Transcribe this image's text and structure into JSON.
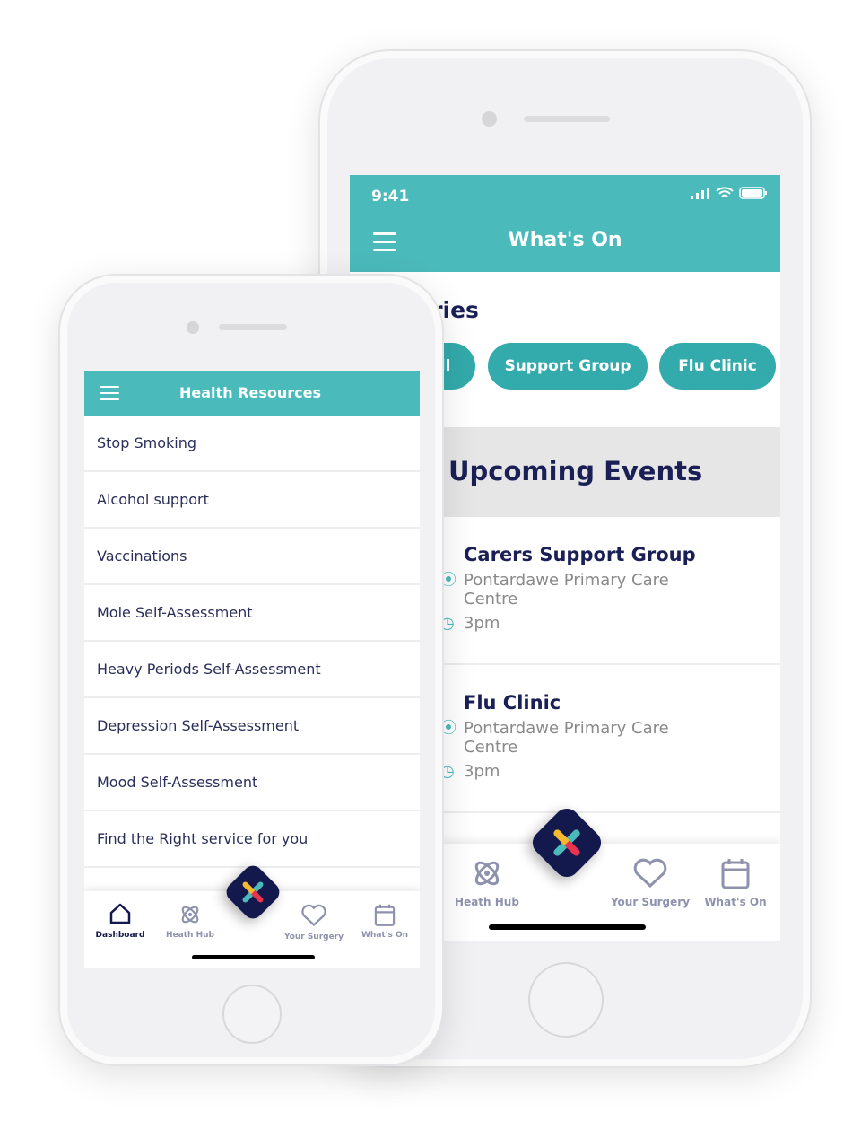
{
  "right_phone": {
    "status": {
      "time": "9:41"
    },
    "header": {
      "title": "What's On"
    },
    "categories": {
      "heading": "Categories",
      "chips": [
        "All",
        "Support Group",
        "Flu Clinic"
      ]
    },
    "upcoming": {
      "heading": "Upcoming Events",
      "events": [
        {
          "title": "Carers Support Group",
          "location": "Pontardawe Primary Care Centre",
          "time": "3pm"
        },
        {
          "title": "Flu Clinic",
          "location": "Pontardawe Primary Care Centre",
          "time": "3pm"
        }
      ]
    },
    "nav": [
      {
        "label": "Heath Hub",
        "icon": "atom-icon"
      },
      {
        "label": "Your Surgery",
        "icon": "heart-icon"
      },
      {
        "label": "What's On",
        "icon": "calendar-icon"
      }
    ]
  },
  "left_phone": {
    "header": {
      "title": "Health Resources"
    },
    "items": [
      "Stop Smoking",
      "Alcohol support",
      "Vaccinations",
      "Mole Self-Assessment",
      "Heavy Periods Self-Assessment",
      "Depression Self-Assessment",
      "Mood Self-Assessment",
      "Find the Right service for you"
    ],
    "nav": [
      {
        "label": "Dashboard",
        "icon": "home-icon",
        "active": true
      },
      {
        "label": "Heath Hub",
        "icon": "atom-icon"
      },
      {
        "label": "Your Surgery",
        "icon": "heart-icon"
      },
      {
        "label": "What's On",
        "icon": "calendar-icon"
      }
    ]
  },
  "colors": {
    "teal": "#4bbabb",
    "navy": "#13194d",
    "chip": "#33aaab"
  }
}
